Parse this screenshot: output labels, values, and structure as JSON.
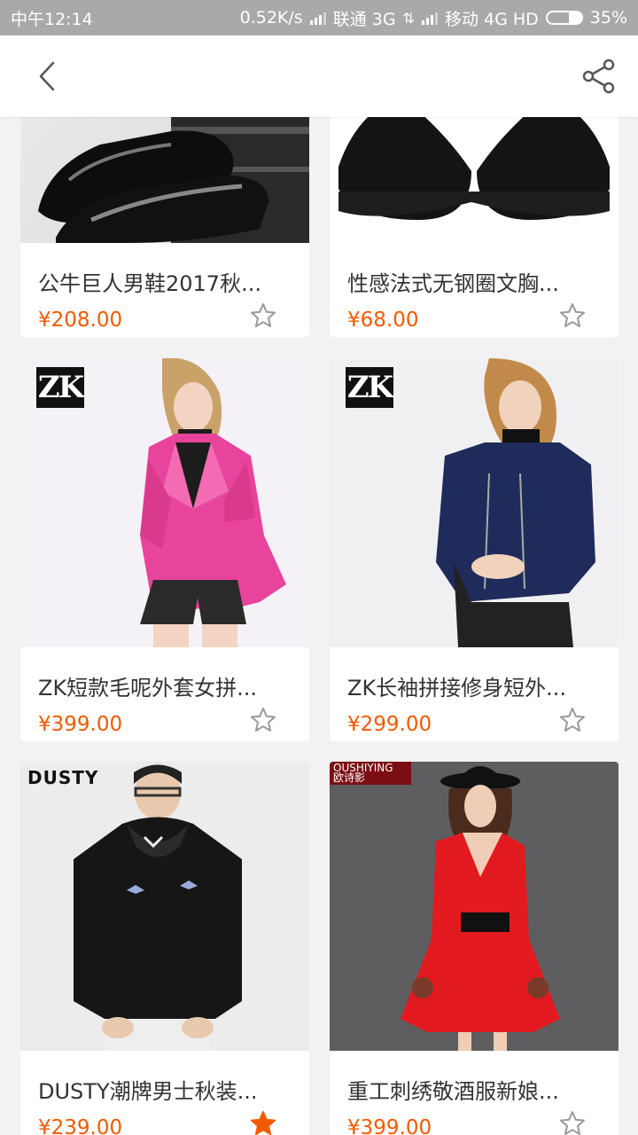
{
  "status_bar": {
    "time": "中午12:14",
    "speed": "0.52K/s",
    "carrier1": "联通 3G",
    "carrier2": "移动 4G HD",
    "battery": "35%",
    "battery_level": 0.35
  },
  "header": {
    "back_icon": "chevron-left-icon",
    "share_icon": "share-icon"
  },
  "colors": {
    "price": "#f25a00",
    "star_active": "#f25a00",
    "star_inactive": "#999999"
  },
  "products": [
    {
      "title": "公牛巨人男鞋2017秋...",
      "price": "¥208.00",
      "favorited": false,
      "image": "black-leather-shoes"
    },
    {
      "title": "性感法式无钢圈文胸...",
      "price": "¥68.00",
      "favorited": false,
      "image": "black-bra"
    },
    {
      "title": "ZK短款毛呢外套女拼...",
      "price": "¥399.00",
      "favorited": false,
      "image": "pink-coat-model",
      "brand": "Z K"
    },
    {
      "title": "ZK长袖拼接修身短外...",
      "price": "¥299.00",
      "favorited": false,
      "image": "navy-jacket-model",
      "brand": "Z K"
    },
    {
      "title": "DUSTY潮牌男士秋装...",
      "price": "¥239.00",
      "favorited": true,
      "image": "black-hoodie-model",
      "brand": "DUSTY"
    },
    {
      "title": "重工刺绣敬酒服新娘...",
      "price": "¥399.00",
      "favorited": false,
      "image": "red-dress-model",
      "brand": "OUSHIYING 欧诗影"
    }
  ]
}
